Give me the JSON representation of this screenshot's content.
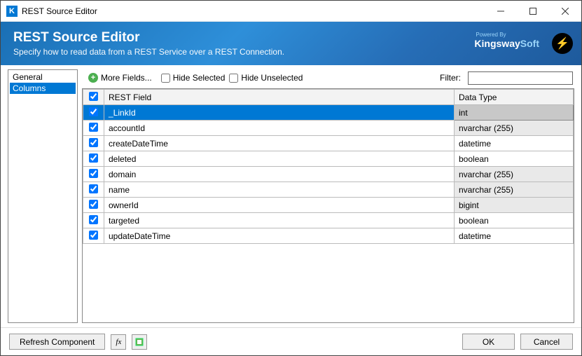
{
  "window": {
    "title": "REST Source Editor"
  },
  "banner": {
    "title": "REST Source Editor",
    "subtitle": "Specify how to read data from a REST Service over a REST Connection.",
    "powered_by": "Powered By",
    "brand_1": "Kingsway",
    "brand_2": "Soft"
  },
  "sidebar": {
    "items": [
      {
        "label": "General",
        "selected": false
      },
      {
        "label": "Columns",
        "selected": true
      }
    ]
  },
  "toolbar": {
    "more_fields": "More Fields...",
    "hide_selected": "Hide Selected",
    "hide_unselected": "Hide Unselected",
    "filter_label": "Filter:",
    "filter_value": ""
  },
  "grid": {
    "header_field": "REST Field",
    "header_type": "Data Type",
    "rows": [
      {
        "checked": true,
        "field": "_LinkId",
        "type": "int",
        "type_shaded": true,
        "selected": true
      },
      {
        "checked": true,
        "field": "accountId",
        "type": "nvarchar (255)",
        "type_shaded": true,
        "selected": false
      },
      {
        "checked": true,
        "field": "createDateTime",
        "type": "datetime",
        "type_shaded": false,
        "selected": false
      },
      {
        "checked": true,
        "field": "deleted",
        "type": "boolean",
        "type_shaded": false,
        "selected": false
      },
      {
        "checked": true,
        "field": "domain",
        "type": "nvarchar (255)",
        "type_shaded": true,
        "selected": false
      },
      {
        "checked": true,
        "field": "name",
        "type": "nvarchar (255)",
        "type_shaded": true,
        "selected": false
      },
      {
        "checked": true,
        "field": "ownerId",
        "type": "bigint",
        "type_shaded": true,
        "selected": false
      },
      {
        "checked": true,
        "field": "targeted",
        "type": "boolean",
        "type_shaded": false,
        "selected": false
      },
      {
        "checked": true,
        "field": "updateDateTime",
        "type": "datetime",
        "type_shaded": false,
        "selected": false
      }
    ]
  },
  "footer": {
    "refresh": "Refresh Component",
    "ok": "OK",
    "cancel": "Cancel"
  }
}
